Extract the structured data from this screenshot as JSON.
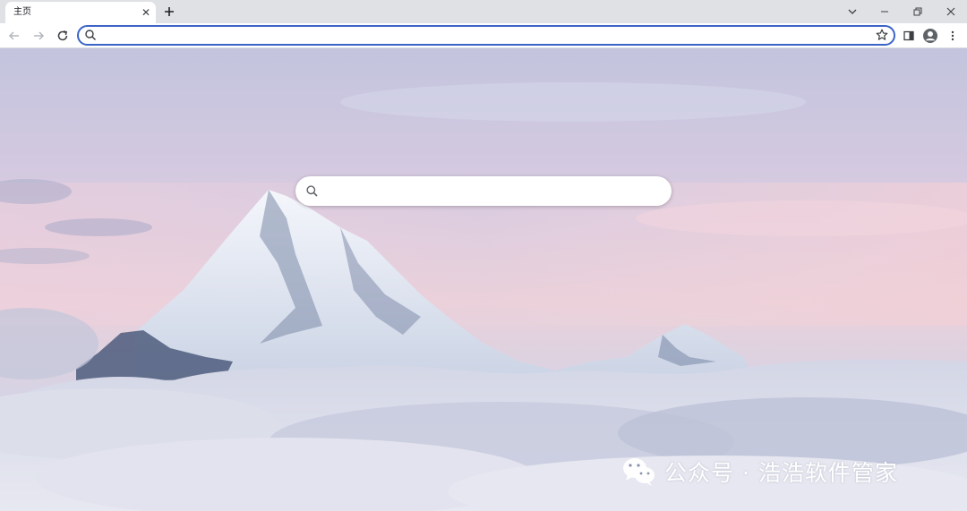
{
  "tab": {
    "title": "主页",
    "close_glyph": "✕"
  },
  "toolbar": {
    "address_value": "",
    "address_placeholder": ""
  },
  "ntp": {
    "search_placeholder": ""
  },
  "watermark": {
    "text": "公众号 · 浩浩软件管家"
  },
  "icons": {
    "back": "back-arrow-icon",
    "forward": "forward-arrow-icon",
    "reload": "reload-icon",
    "search": "search-icon",
    "bookmark": "star-icon",
    "side_panel": "side-panel-icon",
    "profile": "profile-avatar-icon",
    "menu": "kebab-menu-icon",
    "tab_search": "chevron-down-icon",
    "minimize": "minimize-icon",
    "restore": "restore-icon",
    "close": "close-icon",
    "new_tab": "plus-icon",
    "watermark_logo": "wechat-logo-icon"
  },
  "colors": {
    "tabstrip": "#dfe1e5",
    "omnibox_focus": "#3c64c8",
    "sky_top": "#c6c5de",
    "sky_pink": "#e9cfd8",
    "cloud": "#dfe0ec"
  }
}
